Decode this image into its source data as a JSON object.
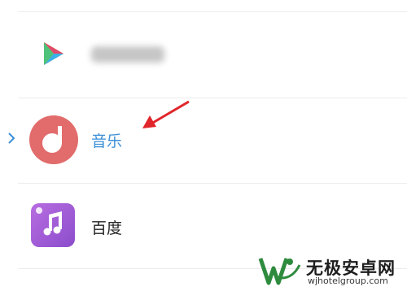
{
  "apps": [
    {
      "label": "",
      "icon": "play-triangle-icon",
      "blurred": true
    },
    {
      "label": "音乐",
      "icon": "music-note-icon",
      "selected": true
    },
    {
      "label": "百度",
      "icon": "music-note-square-icon"
    }
  ],
  "colors": {
    "selected_text": "#3b8fd8",
    "music_icon_bg": "#e26b6b",
    "baidu_icon_bg": "#a35bd6",
    "arrow": "#e0262b"
  },
  "watermark": {
    "title": "无极安卓网",
    "url": "wjhotelgroup.com"
  }
}
